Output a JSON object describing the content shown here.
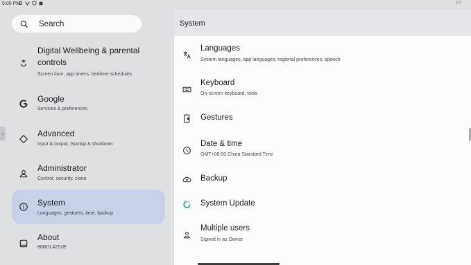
{
  "status_bar": {
    "time": "5:09 PM",
    "right_indicator": "<>"
  },
  "search": {
    "placeholder": "Search"
  },
  "left_menu": [
    {
      "icon": "wellbeing-icon",
      "title": "Digital Wellbeing & parental controls",
      "subtitle": "Screen time, app timers, bedtime schedules"
    },
    {
      "icon": "google-icon",
      "title": "Google",
      "subtitle": "Services & preferences"
    },
    {
      "icon": "advanced-icon",
      "title": "Advanced",
      "subtitle": "Input & output, Startup & shutdown"
    },
    {
      "icon": "administrator-icon",
      "title": "Administrator",
      "subtitle": "Control, security, clone"
    },
    {
      "icon": "info-icon",
      "title": "System",
      "subtitle": "Languages, gestures, time, backup",
      "selected": true
    },
    {
      "icon": "tablet-icon",
      "title": "About",
      "subtitle": "86BDL4252E"
    }
  ],
  "right_panel": {
    "title": "System",
    "items": [
      {
        "icon": "translate-icon",
        "title": "Languages",
        "subtitle": "System languages, app languages, regional preferences, speech"
      },
      {
        "icon": "keyboard-icon",
        "title": "Keyboard",
        "subtitle": "On-screen keyboard, tools"
      },
      {
        "icon": "gestures-icon",
        "title": "Gestures",
        "subtitle": ""
      },
      {
        "icon": "clock-icon",
        "title": "Date & time",
        "subtitle": "GMT+08:00 China Standard Time"
      },
      {
        "icon": "backup-icon",
        "title": "Backup",
        "subtitle": ""
      },
      {
        "icon": "system-update-icon",
        "title": "System Update",
        "subtitle": ""
      },
      {
        "icon": "users-icon",
        "title": "Multiple users",
        "subtitle": "Signed in as Owner"
      }
    ]
  },
  "colors": {
    "selected_bg": "#c7d2e6",
    "left_bg": "#dfe0e2",
    "update_icon": "#1aa08f"
  }
}
